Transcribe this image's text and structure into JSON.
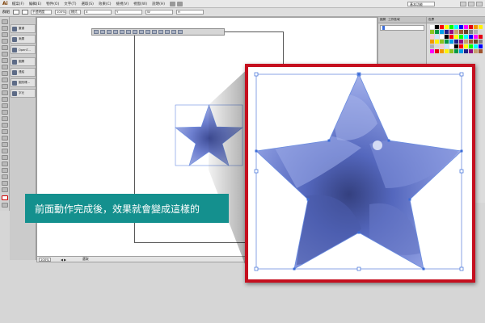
{
  "caption": {
    "text": "前面動作完成後，效果就會變成這樣的"
  },
  "app": {
    "logo": "Ai",
    "menu": [
      "檔案(F)",
      "編輯(E)",
      "物件(O)",
      "文字(T)",
      "選取(S)",
      "效果(C)",
      "檢視(V)",
      "視窗(W)",
      "說明(H)"
    ],
    "workspace": "基本功能"
  },
  "controlbar": {
    "label": "群組",
    "fields": [
      "不透明度",
      "100%",
      "樣式",
      "X",
      "Y",
      "W",
      "H"
    ]
  },
  "panels": {
    "collapsed": [
      {
        "icon": "stroke-icon",
        "label": "筆畫"
      },
      {
        "icon": "gradient-icon",
        "label": "漸層"
      },
      {
        "icon": "opentype-icon",
        "label": "OpenT..."
      },
      {
        "icon": "layers-icon",
        "label": "圖層"
      },
      {
        "icon": "links-icon",
        "label": "連結"
      },
      {
        "icon": "graphic-styles-icon",
        "label": "圖形樣..."
      },
      {
        "icon": "character-icon",
        "label": "字元"
      }
    ],
    "right_tabs": [
      "圖層",
      "工作區域"
    ],
    "swatch_tab": "色票"
  },
  "statusbar": {
    "zoom": "100%",
    "label": "選取"
  },
  "colors": {
    "accent_teal": "#14908e",
    "callout_border": "#c50f1f",
    "star_fill": "#5a6cc0",
    "selection_blue": "#3b6cd8"
  }
}
